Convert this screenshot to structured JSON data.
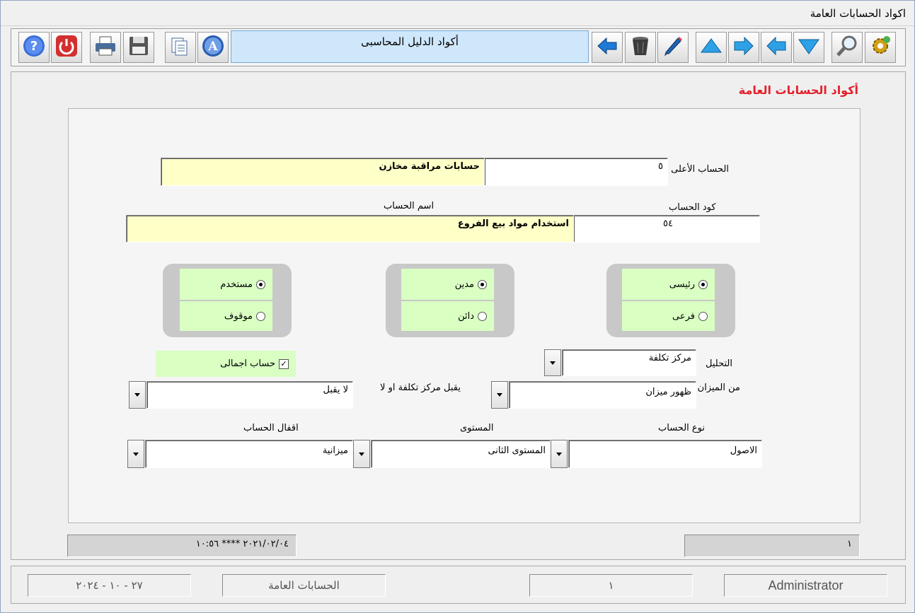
{
  "window": {
    "title": "اكواد الحسابات العامة"
  },
  "toolbar": {
    "title": "أكواد الدليل المحاسبى",
    "buttons_left": [
      {
        "name": "help-icon",
        "color": "#3b6fd6"
      },
      {
        "name": "power-icon",
        "color": "#d32f2f"
      },
      {
        "name": "printer-icon",
        "color": "#4a6e9a"
      },
      {
        "name": "save-disk-icon",
        "color": "#555555"
      },
      {
        "name": "copy-documents-icon",
        "color": "#4a6e9a"
      },
      {
        "name": "font-a-icon",
        "color": "#2a5db0"
      }
    ],
    "buttons_right": [
      {
        "name": "back-arrow-icon",
        "color": "#1e7ad6"
      },
      {
        "name": "trash-icon",
        "color": "#3c3c3c"
      },
      {
        "name": "pencil-icon",
        "color": "#1e64b4"
      },
      {
        "name": "arrow-up-icon",
        "color": "#2ea0e6"
      },
      {
        "name": "arrow-right-icon",
        "color": "#2ea0e6"
      },
      {
        "name": "arrow-left-icon",
        "color": "#2ea0e6"
      },
      {
        "name": "arrow-down-icon",
        "color": "#2ea0e6"
      },
      {
        "name": "magnifier-icon",
        "color": "#6a6a6a"
      },
      {
        "name": "settings-gear-icon",
        "color": "#d4a017"
      }
    ]
  },
  "form": {
    "title": "أكواد الحسابات العامة",
    "parent_account": {
      "label": "الحساب الأعلى",
      "code": "٥",
      "name": "حسابات مراقبة مخازن"
    },
    "account_code": {
      "label": "كود الحساب",
      "value": "٥٤"
    },
    "account_name": {
      "label": "اسم الحساب",
      "value": "استخدام مواد بيع الفروع"
    },
    "radio_groups": [
      {
        "options": [
          {
            "label": "رئيسى",
            "selected": true
          },
          {
            "label": "فرعى",
            "selected": false
          }
        ]
      },
      {
        "options": [
          {
            "label": "مدين",
            "selected": true
          },
          {
            "label": "دائن",
            "selected": false
          }
        ]
      },
      {
        "options": [
          {
            "label": "مستخدم",
            "selected": true
          },
          {
            "label": "موقوف",
            "selected": false
          }
        ]
      }
    ],
    "analysis": {
      "label": "التحليل",
      "value": "مركز تكلفة"
    },
    "total_account": {
      "label": "حساب اجمالى",
      "checked": true,
      "mark": "✓"
    },
    "balance": {
      "label": "من الميزان",
      "value": "ظهور ميزان"
    },
    "cost_center": {
      "label": "يقبل مركز تكلفة او لا",
      "value": "لا يقبل"
    },
    "account_type": {
      "label": "نوع الحساب",
      "value": "الاصول"
    },
    "level": {
      "label": "المستوى",
      "value": "المستوى الثانى"
    },
    "account_closing": {
      "label": "اقفال الحساب",
      "value": "ميزانية"
    }
  },
  "status": {
    "left": "٢٠٢١/٠٢/٠٤ **** ١٠:٥٦",
    "right": "١"
  },
  "footer": {
    "date": "٢٧ - ١٠ - ٢٠٢٤",
    "screen": "الحسابات العامة",
    "number": "١",
    "user": "Administrator"
  }
}
